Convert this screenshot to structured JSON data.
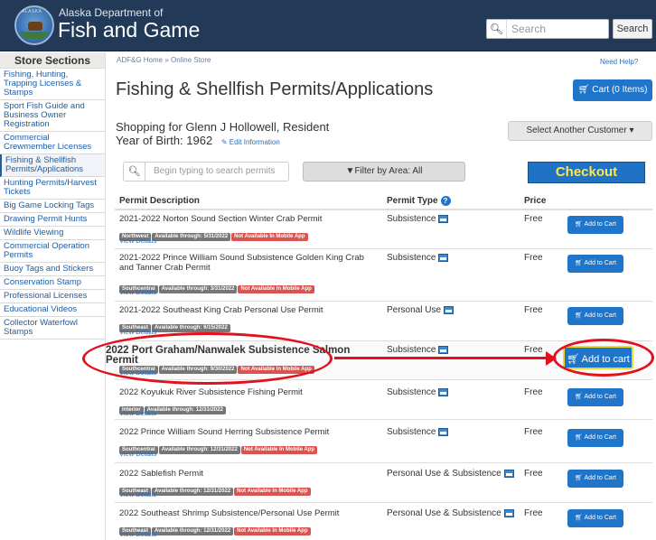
{
  "header": {
    "brand_small": "Alaska Department of",
    "brand_big": "Fish and Game",
    "logo_text": "ALASKA",
    "search_placeholder": "Search",
    "search_button": "Search",
    "colors": {
      "header_bg": "#223a57",
      "accent": "#1e75c9",
      "checkout_text": "#ffe74a",
      "annotation": "#e3101d"
    }
  },
  "sidebar": {
    "title": "Store Sections",
    "items": [
      {
        "label": "Fishing, Hunting, Trapping Licenses & Stamps"
      },
      {
        "label": "Sport Fish Guide and Business Owner Registration"
      },
      {
        "label": "Commercial Crewmember Licenses"
      },
      {
        "label": "Fishing & Shellfish Permits/Applications",
        "active": true
      },
      {
        "label": "Hunting Permits/Harvest Tickets"
      },
      {
        "label": "Big Game Locking Tags"
      },
      {
        "label": "Drawing Permit Hunts"
      },
      {
        "label": "Wildlife Viewing"
      },
      {
        "label": "Commercial Operation Permits"
      },
      {
        "label": "Buoy Tags and Stickers"
      },
      {
        "label": "Conservation Stamp"
      },
      {
        "label": "Professional Licenses"
      },
      {
        "label": "Educational Videos"
      },
      {
        "label": "Collector Waterfowl Stamps"
      }
    ]
  },
  "main": {
    "breadcrumb": "ADF&G Home » Online Store",
    "help": "Need Help?",
    "title": "Fishing & Shellfish Permits/Applications",
    "cart_label": "Cart (0 Items)",
    "shopping_for": "Shopping for Glenn J Hollowell, Resident",
    "year_of_birth": "Year of Birth: 1962",
    "edit_info": "Edit Information",
    "select_customer": "Select Another Customer ▾",
    "permit_search_placeholder": "Begin typing to search permits",
    "filter_label": "Filter by Area: All",
    "checkout_label": "Checkout",
    "columns": {
      "description": "Permit Description",
      "type": "Permit Type",
      "price": "Price"
    },
    "view_details": "View Details",
    "permits": [
      {
        "name": "2021-2022 Norton Sound Section Winter Crab Permit",
        "region": "Northwest",
        "available": "Available through: 5/31/2022",
        "not_mobile": "Not Available In Mobile App",
        "type": "Subsistence",
        "price": "Free",
        "button": "Add to Cart"
      },
      {
        "name": "2021-2022 Prince William Sound Subsistence Golden King Crab and Tanner Crab Permit",
        "region": "Southcentral",
        "available": "Available through: 3/31/2022",
        "not_mobile": "Not Available In Mobile App",
        "type": "Subsistence",
        "price": "Free",
        "button": "Add to Cart"
      },
      {
        "name": "2021-2022 Southeast King Crab Personal Use Permit",
        "region": "Southeast",
        "available": "Available through: 6/15/2022",
        "not_mobile": "",
        "type": "Personal Use",
        "price": "Free",
        "button": "Add to Cart"
      },
      {
        "name": "2022 Port Graham/Nanwalek Subsistence Salmon Permit",
        "region": "Southcentral",
        "available": "Available through: 9/30/2022",
        "not_mobile": "Not Available In Mobile App",
        "type": "Subsistence",
        "price": "Free",
        "button": "Add to cart",
        "highlighted": true
      },
      {
        "name": "2022 Koyukuk River Subsistence Fishing Permit",
        "region": "Interior",
        "available": "Available through: 12/31/2022",
        "not_mobile": "",
        "type": "Subsistence",
        "price": "Free",
        "button": "Add to Cart"
      },
      {
        "name": "2022 Prince William Sound Herring Subsistence Permit",
        "region": "Southcentral",
        "available": "Available through: 12/31/2022",
        "not_mobile": "Not Available In Mobile App",
        "type": "Subsistence",
        "price": "Free",
        "button": "Add to Cart"
      },
      {
        "name": "2022 Sablefish Permit",
        "region": "Southeast",
        "available": "Available through: 12/31/2022",
        "not_mobile": "Not Available In Mobile App",
        "type": "Personal Use & Subsistence",
        "price": "Free",
        "button": "Add to Cart"
      },
      {
        "name": "2022 Southeast Shrimp Subsistence/Personal Use Permit",
        "region": "Southeast",
        "available": "Available through: 12/31/2022",
        "not_mobile": "Not Available In Mobile App",
        "type": "Personal Use & Subsistence",
        "price": "Free",
        "button": "Add to Cart"
      }
    ]
  }
}
